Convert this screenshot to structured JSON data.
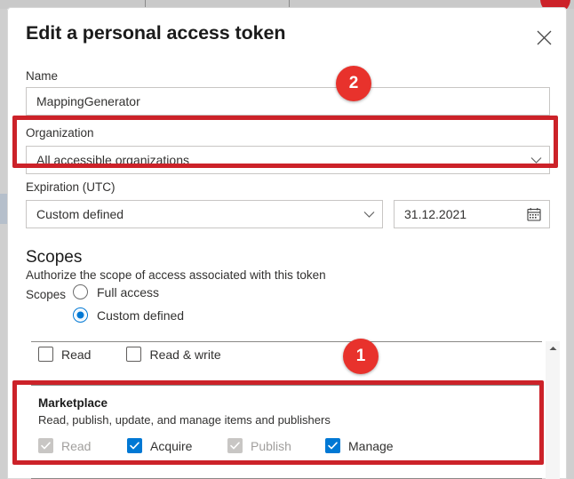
{
  "dialog": {
    "title": "Edit a personal access token",
    "close_icon": "close-icon"
  },
  "form": {
    "name": {
      "label": "Name",
      "value": "MappingGenerator",
      "placeholder": ""
    },
    "organization": {
      "label": "Organization",
      "value": "All accessible organizations",
      "chevron_icon": "chevron-down-icon"
    },
    "expiration": {
      "label": "Expiration (UTC)",
      "preset_value": "Custom defined",
      "chevron_icon": "chevron-down-icon",
      "date_value": "31.12.2021",
      "calendar_icon": "calendar-icon"
    }
  },
  "scopes": {
    "heading": "Scopes",
    "description": "Authorize the scope of access associated with this token",
    "inline_label": "Scopes",
    "radios": [
      {
        "label": "Full access",
        "checked": false
      },
      {
        "label": "Custom defined",
        "checked": true
      }
    ],
    "top_row": [
      {
        "label": "Read",
        "state": "unchecked"
      },
      {
        "label": "Read & write",
        "state": "unchecked"
      }
    ],
    "groups": [
      {
        "title": "Marketplace",
        "description": "Read, publish, update, and manage items and publishers",
        "items": [
          {
            "label": "Read",
            "state": "disabled-checked"
          },
          {
            "label": "Acquire",
            "state": "checked"
          },
          {
            "label": "Publish",
            "state": "disabled-checked"
          },
          {
            "label": "Manage",
            "state": "checked"
          }
        ]
      }
    ],
    "scrollbar": {
      "up_arrow_icon": "scroll-up-arrow-icon"
    }
  },
  "annotations": {
    "accent_color": "#cc2229",
    "badge_color": "#e8322c",
    "markers": [
      {
        "label": "1",
        "target": "marketplace-scope-group"
      },
      {
        "label": "2",
        "target": "organization-field"
      }
    ]
  }
}
